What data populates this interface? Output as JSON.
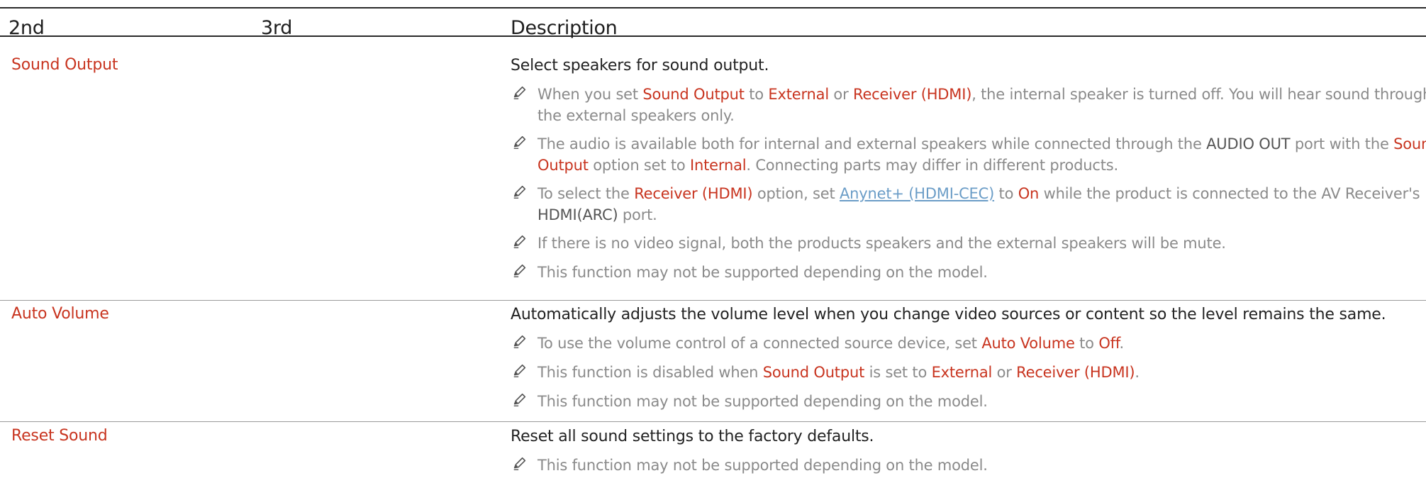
{
  "headers": {
    "col2": "2nd",
    "col3": "3rd",
    "col_desc": "Description"
  },
  "rows": [
    {
      "menu": "Sound Output",
      "description": "Select speakers for sound output.",
      "notes": [
        {
          "before": "When you set ",
          "hl1": "Sound Output",
          "mid1": " to ",
          "hl2": "External",
          "mid2": " or ",
          "hl3": "Receiver (HDMI)",
          "line1_rest": ", the internal speaker is turned off. You will hear sound through",
          "line2": "the external speakers only."
        },
        {
          "before": "The audio is available both for internal and external speakers while connected through the ",
          "port": "AUDIO OUT",
          "mid1": " port with the ",
          "hl1a": "Sound",
          "hl1b": "Output",
          "mid2": " option set to ",
          "hl2": "Internal",
          "rest": ". Connecting parts may differ in different products."
        },
        {
          "before": "To select the ",
          "hl1": "Receiver (HDMI)",
          "mid1": " option, set ",
          "link": "Anynet+ (HDMI-CEC)",
          "mid2": " to ",
          "hl2": "On",
          "rest": " while the product is connected to the AV Receiver's",
          "port": "HDMI(ARC)",
          "line2_rest": " port."
        },
        {
          "text": "If there is no video signal, both the products speakers and the external speakers will be mute."
        },
        {
          "text": "This function may not be supported depending on the model."
        }
      ]
    },
    {
      "menu": "Auto Volume",
      "description": "Automatically adjusts the volume level when you change video sources or content so the level remains the same.",
      "notes": [
        {
          "before": "To use the volume control of a connected source device, set ",
          "hl1": "Auto Volume",
          "mid1": " to ",
          "hl2": "Off",
          "rest": "."
        },
        {
          "before": "This function is disabled when ",
          "hl1": "Sound Output",
          "mid1": " is set to ",
          "hl2": "External",
          "mid2": " or ",
          "hl3": "Receiver (HDMI)",
          "rest": "."
        },
        {
          "text": "This function may not be supported depending on the model."
        }
      ]
    },
    {
      "menu": "Reset Sound",
      "description": "Reset all sound settings to the factory defaults.",
      "notes": [
        {
          "text": "This function may not be supported depending on the model."
        }
      ]
    }
  ],
  "colors": {
    "highlight": "#c8341f",
    "note_text": "#8a8a8a",
    "link": "#6b9dc7"
  }
}
